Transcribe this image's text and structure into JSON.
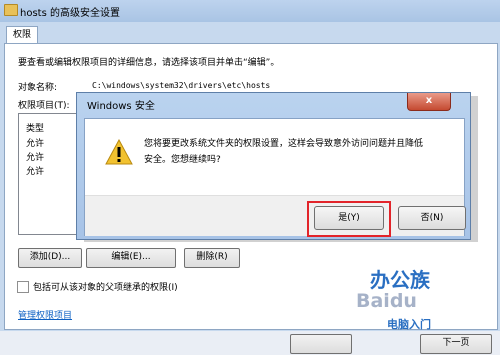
{
  "window": {
    "title": "hosts 的高级安全设置",
    "tab": "权限"
  },
  "panel": {
    "intro": "要查看或编辑权限项目的详细信息，请选择该项目并单击“编辑”。",
    "object_label": "对象名称:",
    "object_path": "C:\\windows\\system32\\drivers\\etc\\hosts",
    "perm_entries_label": "权限项目(T):",
    "list_header_type": "类型",
    "list_rows": [
      "允许",
      "允许",
      "允许"
    ],
    "add_button": "添加(D)...",
    "edit_button": "编辑(E)...",
    "delete_button": "删除(R)",
    "inherit_checkbox": "包括可从该对象的父项继承的权限(I)",
    "manage_link": "管理权限项目"
  },
  "dialog": {
    "title": "Windows 安全",
    "close_glyph": "x",
    "message_line1": "您将要更改系统文件夹的权限设置，这样会导致意外访问问题并且降低",
    "message_line2": "安全。您想继续吗?",
    "yes_button": "是(Y)",
    "no_button": "否(N)",
    "warning_glyph": "!",
    "warning_color": "#f2c230",
    "highlight_color": "#e2242a"
  },
  "watermark": {
    "big": "办公族",
    "small": "Baidu",
    "brand": "电脑入门"
  },
  "footer": {
    "button_right": "下一页"
  }
}
